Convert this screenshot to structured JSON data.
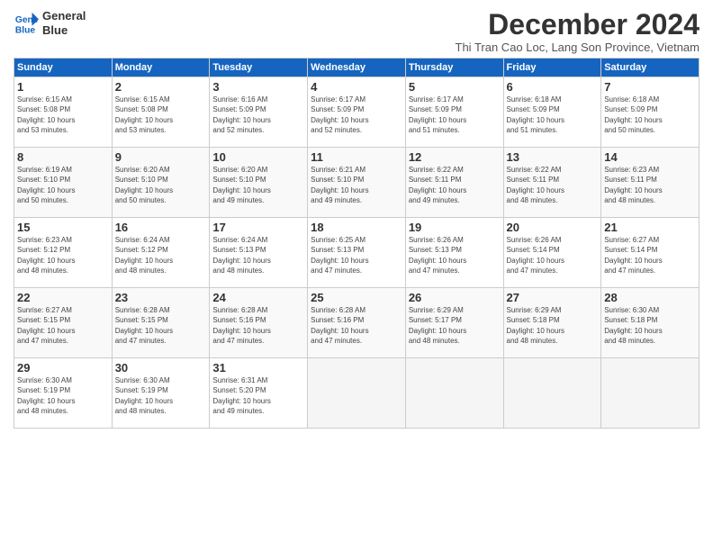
{
  "logo": {
    "line1": "General",
    "line2": "Blue"
  },
  "title": "December 2024",
  "subtitle": "Thi Tran Cao Loc, Lang Son Province, Vietnam",
  "header": {
    "days": [
      "Sunday",
      "Monday",
      "Tuesday",
      "Wednesday",
      "Thursday",
      "Friday",
      "Saturday"
    ]
  },
  "weeks": [
    [
      {
        "day": "1",
        "info": "Sunrise: 6:15 AM\nSunset: 5:08 PM\nDaylight: 10 hours\nand 53 minutes."
      },
      {
        "day": "2",
        "info": "Sunrise: 6:15 AM\nSunset: 5:08 PM\nDaylight: 10 hours\nand 53 minutes."
      },
      {
        "day": "3",
        "info": "Sunrise: 6:16 AM\nSunset: 5:09 PM\nDaylight: 10 hours\nand 52 minutes."
      },
      {
        "day": "4",
        "info": "Sunrise: 6:17 AM\nSunset: 5:09 PM\nDaylight: 10 hours\nand 52 minutes."
      },
      {
        "day": "5",
        "info": "Sunrise: 6:17 AM\nSunset: 5:09 PM\nDaylight: 10 hours\nand 51 minutes."
      },
      {
        "day": "6",
        "info": "Sunrise: 6:18 AM\nSunset: 5:09 PM\nDaylight: 10 hours\nand 51 minutes."
      },
      {
        "day": "7",
        "info": "Sunrise: 6:18 AM\nSunset: 5:09 PM\nDaylight: 10 hours\nand 50 minutes."
      }
    ],
    [
      {
        "day": "8",
        "info": "Sunrise: 6:19 AM\nSunset: 5:10 PM\nDaylight: 10 hours\nand 50 minutes."
      },
      {
        "day": "9",
        "info": "Sunrise: 6:20 AM\nSunset: 5:10 PM\nDaylight: 10 hours\nand 50 minutes."
      },
      {
        "day": "10",
        "info": "Sunrise: 6:20 AM\nSunset: 5:10 PM\nDaylight: 10 hours\nand 49 minutes."
      },
      {
        "day": "11",
        "info": "Sunrise: 6:21 AM\nSunset: 5:10 PM\nDaylight: 10 hours\nand 49 minutes."
      },
      {
        "day": "12",
        "info": "Sunrise: 6:22 AM\nSunset: 5:11 PM\nDaylight: 10 hours\nand 49 minutes."
      },
      {
        "day": "13",
        "info": "Sunrise: 6:22 AM\nSunset: 5:11 PM\nDaylight: 10 hours\nand 48 minutes."
      },
      {
        "day": "14",
        "info": "Sunrise: 6:23 AM\nSunset: 5:11 PM\nDaylight: 10 hours\nand 48 minutes."
      }
    ],
    [
      {
        "day": "15",
        "info": "Sunrise: 6:23 AM\nSunset: 5:12 PM\nDaylight: 10 hours\nand 48 minutes."
      },
      {
        "day": "16",
        "info": "Sunrise: 6:24 AM\nSunset: 5:12 PM\nDaylight: 10 hours\nand 48 minutes."
      },
      {
        "day": "17",
        "info": "Sunrise: 6:24 AM\nSunset: 5:13 PM\nDaylight: 10 hours\nand 48 minutes."
      },
      {
        "day": "18",
        "info": "Sunrise: 6:25 AM\nSunset: 5:13 PM\nDaylight: 10 hours\nand 47 minutes."
      },
      {
        "day": "19",
        "info": "Sunrise: 6:26 AM\nSunset: 5:13 PM\nDaylight: 10 hours\nand 47 minutes."
      },
      {
        "day": "20",
        "info": "Sunrise: 6:26 AM\nSunset: 5:14 PM\nDaylight: 10 hours\nand 47 minutes."
      },
      {
        "day": "21",
        "info": "Sunrise: 6:27 AM\nSunset: 5:14 PM\nDaylight: 10 hours\nand 47 minutes."
      }
    ],
    [
      {
        "day": "22",
        "info": "Sunrise: 6:27 AM\nSunset: 5:15 PM\nDaylight: 10 hours\nand 47 minutes."
      },
      {
        "day": "23",
        "info": "Sunrise: 6:28 AM\nSunset: 5:15 PM\nDaylight: 10 hours\nand 47 minutes."
      },
      {
        "day": "24",
        "info": "Sunrise: 6:28 AM\nSunset: 5:16 PM\nDaylight: 10 hours\nand 47 minutes."
      },
      {
        "day": "25",
        "info": "Sunrise: 6:28 AM\nSunset: 5:16 PM\nDaylight: 10 hours\nand 47 minutes."
      },
      {
        "day": "26",
        "info": "Sunrise: 6:29 AM\nSunset: 5:17 PM\nDaylight: 10 hours\nand 48 minutes."
      },
      {
        "day": "27",
        "info": "Sunrise: 6:29 AM\nSunset: 5:18 PM\nDaylight: 10 hours\nand 48 minutes."
      },
      {
        "day": "28",
        "info": "Sunrise: 6:30 AM\nSunset: 5:18 PM\nDaylight: 10 hours\nand 48 minutes."
      }
    ],
    [
      {
        "day": "29",
        "info": "Sunrise: 6:30 AM\nSunset: 5:19 PM\nDaylight: 10 hours\nand 48 minutes."
      },
      {
        "day": "30",
        "info": "Sunrise: 6:30 AM\nSunset: 5:19 PM\nDaylight: 10 hours\nand 48 minutes."
      },
      {
        "day": "31",
        "info": "Sunrise: 6:31 AM\nSunset: 5:20 PM\nDaylight: 10 hours\nand 49 minutes."
      },
      {
        "day": "",
        "info": ""
      },
      {
        "day": "",
        "info": ""
      },
      {
        "day": "",
        "info": ""
      },
      {
        "day": "",
        "info": ""
      }
    ]
  ]
}
